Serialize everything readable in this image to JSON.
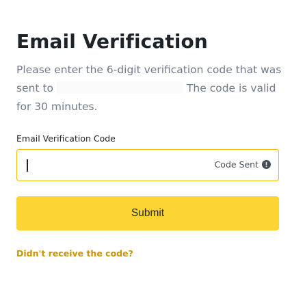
{
  "page": {
    "title": "Email Verification",
    "description": {
      "line1": "Please enter the 6-digit verification code that was",
      "line2_prefix": "sent to",
      "line2_suffix": "The code is valid",
      "line3": "for 30 minutes."
    }
  },
  "form": {
    "code_label": "Email Verification Code",
    "code_value": "",
    "code_sent_label": "Code Sent",
    "code_sent_icon": "info-icon",
    "submit_label": "Submit",
    "resend_link": "Didn't receive the code?"
  },
  "colors": {
    "accent": "#fcd535",
    "focus_border": "#f0b90b",
    "link": "#c99400",
    "text_primary": "#1e2329",
    "text_secondary": "#707a8a"
  }
}
